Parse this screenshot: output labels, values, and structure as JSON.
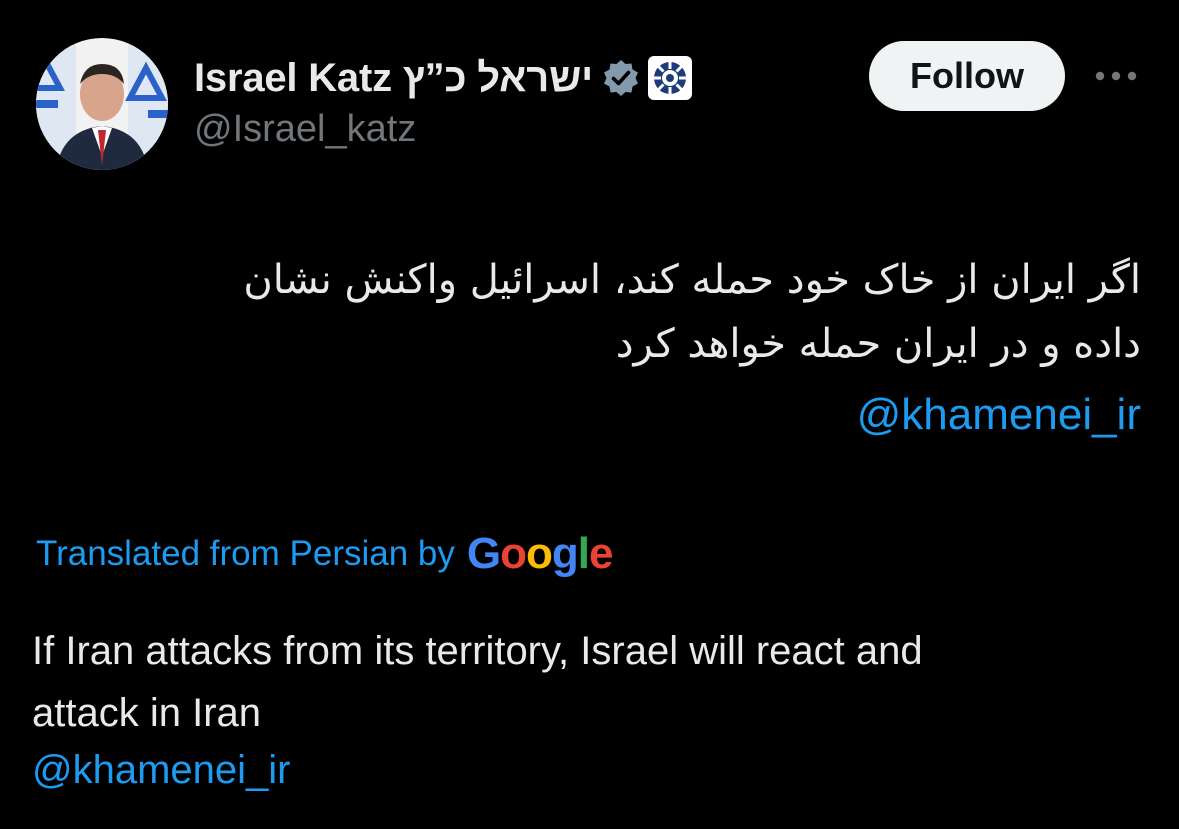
{
  "author": {
    "display_name": "Israel Katz ישראל כ”ץ",
    "handle": "@Israel_katz",
    "verified_badge_icon": "verified-badge-icon",
    "affiliate_badge_icon": "affiliate-emblem-icon",
    "avatar_icon": "avatar-photo"
  },
  "actions": {
    "follow_label": "Follow",
    "more_icon": "more-options-icon"
  },
  "post": {
    "original_lines": [
      "اگر ایران از خاک خود حمله کند، اسرائیل واکنش نشان",
      "داده و در ایران حمله خواهد کرد"
    ],
    "original_mention": "@khamenei_ir",
    "translated_label": "Translated from Persian by",
    "translator_logo": "Google",
    "translation_lines": [
      "If Iran attacks from its territory, Israel will react and",
      "attack in Iran"
    ],
    "translation_mention": "@khamenei_ir"
  },
  "colors": {
    "background": "#000000",
    "text_primary": "#e7e9ea",
    "text_secondary": "#71767b",
    "link": "#1d9bf0",
    "follow_bg": "#eff3f4",
    "google_blue": "#4285f4",
    "google_red": "#ea4335",
    "google_yellow": "#fbbc05",
    "google_green": "#34a853"
  }
}
